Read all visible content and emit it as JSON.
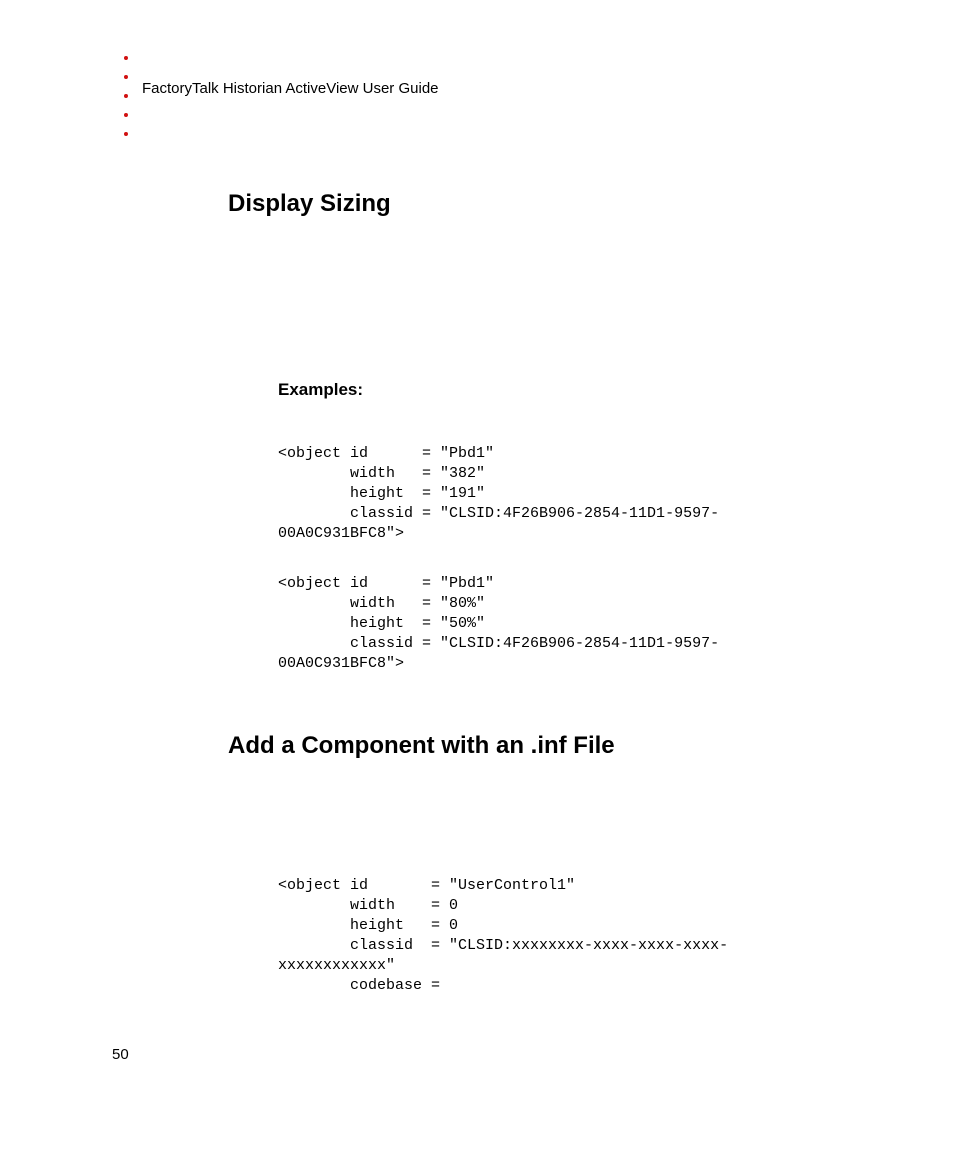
{
  "accent": "#d11010",
  "header": "FactoryTalk Historian ActiveView User Guide",
  "pageNumber": "50",
  "h1a": "Display Sizing",
  "h2a": "Examples:",
  "code1": "<object id      = \"Pbd1\"\n        width   = \"382\"\n        height  = \"191\"\n        classid = \"CLSID:4F26B906-2854-11D1-9597-\n00A0C931BFC8\">",
  "code2": "<object id      = \"Pbd1\"\n        width   = \"80%\"\n        height  = \"50%\"\n        classid = \"CLSID:4F26B906-2854-11D1-9597-\n00A0C931BFC8\">",
  "h1b": "Add a Component with an .inf File",
  "code3": "<object id       = \"UserControl1\"\n        width    = 0\n        height   = 0\n        classid  = \"CLSID:xxxxxxxx-xxxx-xxxx-xxxx-\nxxxxxxxxxxxx\"\n        codebase ="
}
